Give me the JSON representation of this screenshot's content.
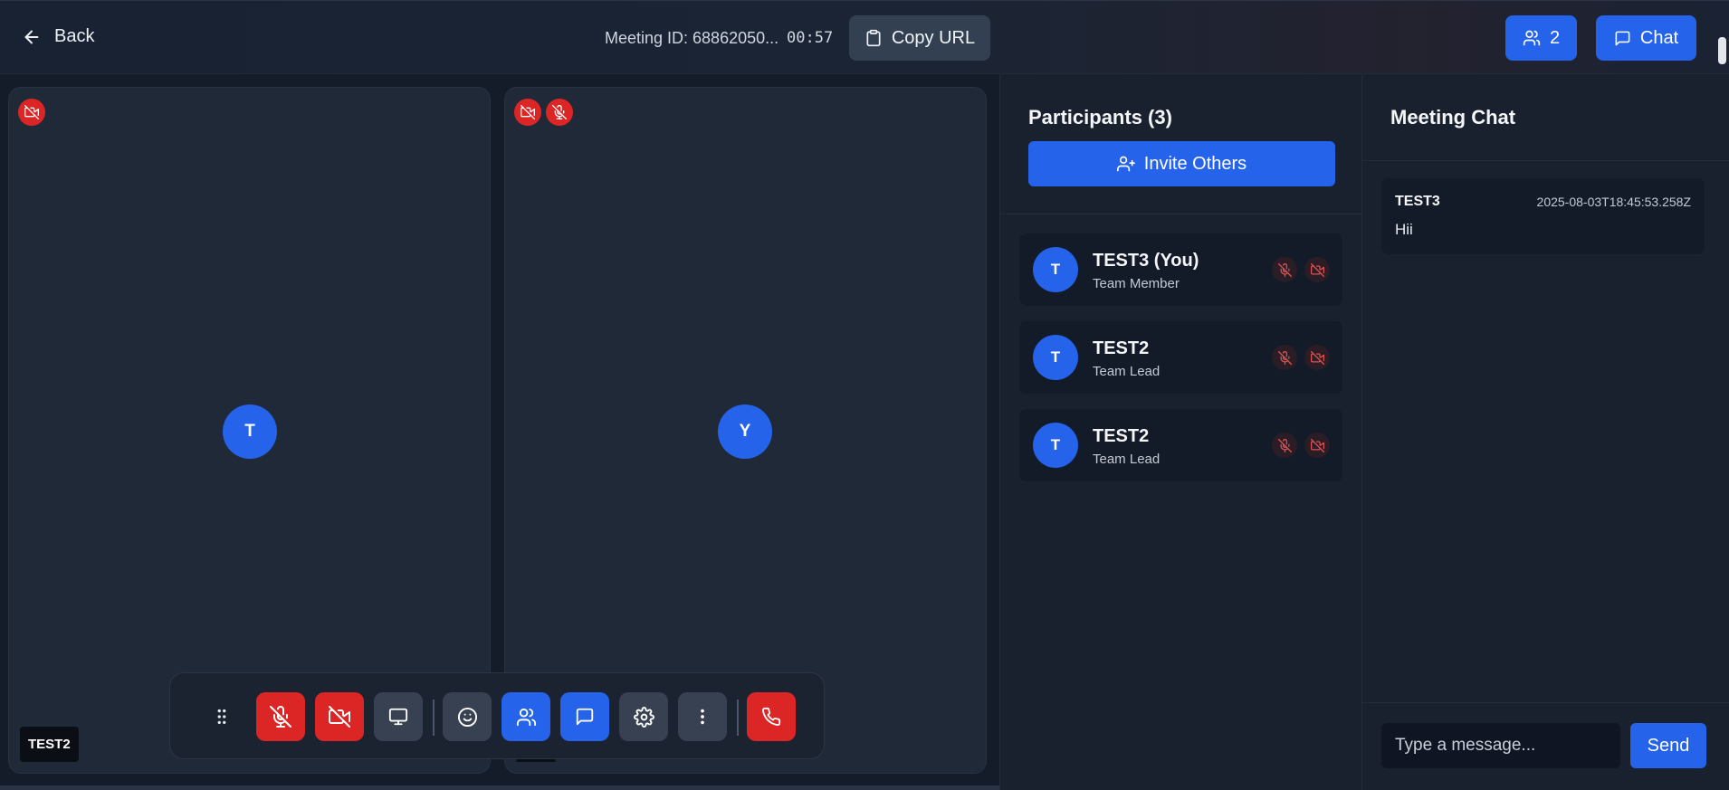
{
  "header": {
    "back_label": "Back",
    "meeting_id": "Meeting ID: 68862050...",
    "timer": "00:57",
    "copy_url_label": "Copy URL",
    "participants_count": "2",
    "chat_label": "Chat"
  },
  "tiles": [
    {
      "initial": "T",
      "name_tag": "TEST2",
      "badges": [
        "camera-off-icon"
      ]
    },
    {
      "initial": "Y",
      "name_tag": "",
      "badges": [
        "camera-off-icon",
        "mic-off-icon"
      ]
    }
  ],
  "controls": [
    "drag-handle-icon",
    "mic-off-icon",
    "camera-off-icon",
    "monitor-icon",
    "smile-icon",
    "users-icon",
    "message-icon",
    "gear-icon",
    "more-vertical-icon",
    "phone-icon"
  ],
  "participants": {
    "title": "Participants (3)",
    "invite_label": "Invite Others",
    "list": [
      {
        "initial": "T",
        "name": "TEST3 (You)",
        "role": "Team Member"
      },
      {
        "initial": "T",
        "name": "TEST2",
        "role": "Team Lead"
      },
      {
        "initial": "T",
        "name": "TEST2",
        "role": "Team Lead"
      }
    ]
  },
  "chat": {
    "title": "Meeting Chat",
    "messages": [
      {
        "author": "TEST3",
        "time": "2025-08-03T18:45:53.258Z",
        "text": "Hii"
      }
    ],
    "input_placeholder": "Type a message...",
    "send_label": "Send"
  },
  "colors": {
    "accent": "#2563eb",
    "danger": "#dc2626",
    "background": "#141b29",
    "panel": "#19202e"
  }
}
